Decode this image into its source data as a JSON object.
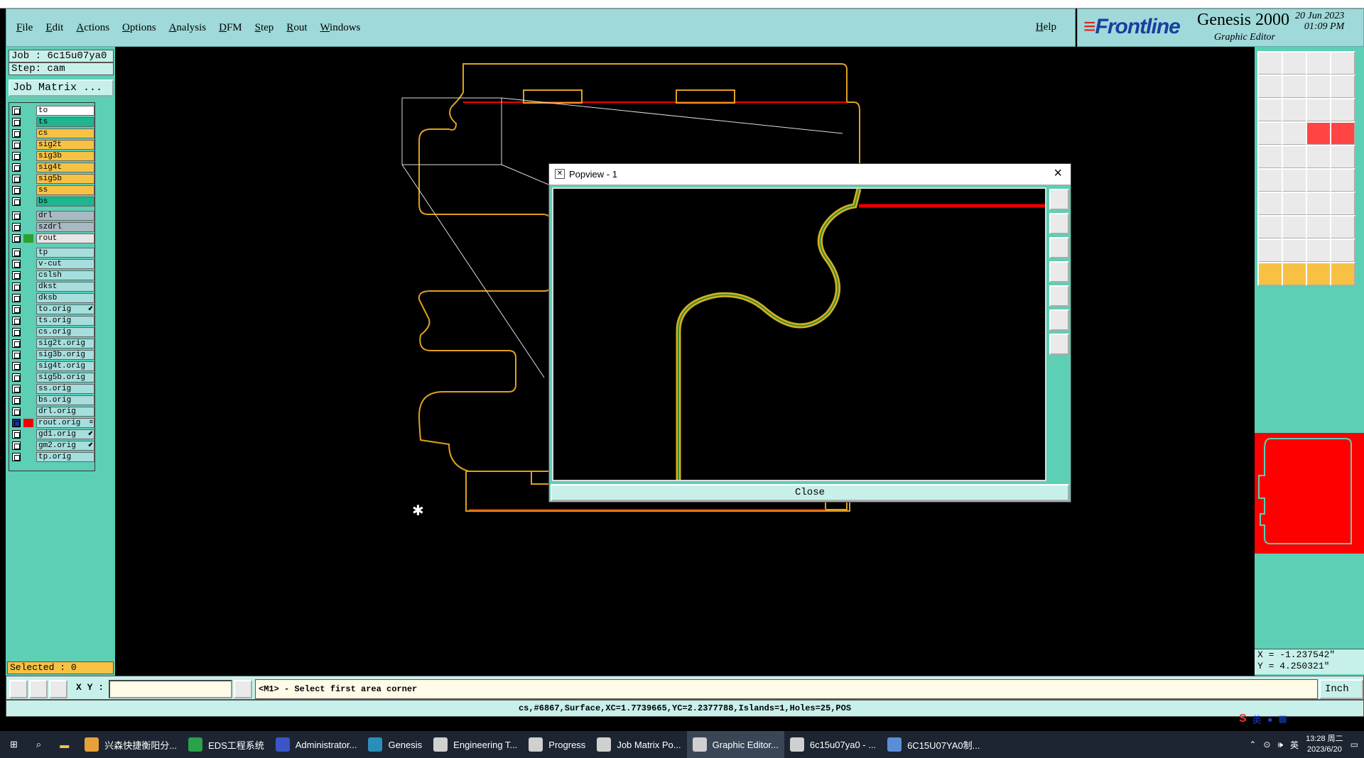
{
  "menubar": {
    "items": [
      "File",
      "Edit",
      "Actions",
      "Options",
      "Analysis",
      "DFM",
      "Step",
      "Rout",
      "Windows"
    ],
    "help": "Help"
  },
  "brand": {
    "logo": "Frontline",
    "product": "Genesis 2000",
    "subtitle": "Graphic Editor",
    "date": "20 Jun 2023",
    "time": "01:09 PM"
  },
  "left_panel": {
    "job": "Job : 6c15u07ya0",
    "step": "Step: cam",
    "job_matrix_button": "Job Matrix ...",
    "layers": [
      {
        "name": "to",
        "color": "#ffffff",
        "mark": ""
      },
      {
        "name": "ts",
        "color": "#1fb58f",
        "mark": ""
      },
      {
        "name": "cs",
        "color": "#f7c244",
        "mark": ""
      },
      {
        "name": "sig2t",
        "color": "#f7c244",
        "mark": ""
      },
      {
        "name": "sig3b",
        "color": "#f7c244",
        "mark": ""
      },
      {
        "name": "sig4t",
        "color": "#f7c244",
        "mark": ""
      },
      {
        "name": "sig5b",
        "color": "#f7c244",
        "mark": ""
      },
      {
        "name": "ss",
        "color": "#f7c244",
        "mark": ""
      },
      {
        "name": "bs",
        "color": "#1fb58f",
        "mark": ""
      },
      {
        "name": "drl",
        "color": "#a9b9c3",
        "mark": ""
      },
      {
        "name": "szdrl",
        "color": "#a9b9c3",
        "mark": ""
      },
      {
        "name": "rout",
        "color": "#e6e6e6",
        "mark": ""
      },
      {
        "name": "tp",
        "color": "#a6dede",
        "mark": ""
      },
      {
        "name": "v-cut",
        "color": "#a6dede",
        "mark": ""
      },
      {
        "name": "cslsh",
        "color": "#a6dede",
        "mark": ""
      },
      {
        "name": "dkst",
        "color": "#a6dede",
        "mark": ""
      },
      {
        "name": "dksb",
        "color": "#a6dede",
        "mark": ""
      },
      {
        "name": "to.orig",
        "color": "#a6dede",
        "mark": "⬋"
      },
      {
        "name": "ts.orig",
        "color": "#a6dede",
        "mark": ""
      },
      {
        "name": "cs.orig",
        "color": "#a6dede",
        "mark": ""
      },
      {
        "name": "sig2t.orig",
        "color": "#a6dede",
        "mark": ""
      },
      {
        "name": "sig3b.orig",
        "color": "#a6dede",
        "mark": ""
      },
      {
        "name": "sig4t.orig",
        "color": "#a6dede",
        "mark": ""
      },
      {
        "name": "sig5b.orig",
        "color": "#a6dede",
        "mark": ""
      },
      {
        "name": "ss.orig",
        "color": "#a6dede",
        "mark": ""
      },
      {
        "name": "bs.orig",
        "color": "#a6dede",
        "mark": ""
      },
      {
        "name": "drl.orig",
        "color": "#a6dede",
        "mark": ""
      },
      {
        "name": "rout.orig",
        "color": "#a6dede",
        "mark": "≡"
      },
      {
        "name": "gd1.orig",
        "color": "#a6dede",
        "mark": "⬋"
      },
      {
        "name": "gm2.orig",
        "color": "#a6dede",
        "mark": "⬋"
      },
      {
        "name": "tp.orig",
        "color": "#a6dede",
        "mark": ""
      }
    ],
    "selected": "Selected : 0"
  },
  "coords": {
    "x": "X = -1.237542\"",
    "y": "Y = 4.250321\""
  },
  "cmdbar": {
    "xy_label": "X Y :",
    "xy_value": "",
    "prompt": "<M1> - Select first area corner",
    "units": "Inch"
  },
  "status": "cs,#6867,Surface,XC=1.7739665,YC=2.2377788,Islands=1,Holes=25,POS",
  "popview": {
    "title": "Popview - 1",
    "close_label": "Close"
  },
  "taskbar": {
    "items": [
      {
        "label": "兴森快捷衡阳分...",
        "icon": "flask-icon",
        "color": "#e8a13a"
      },
      {
        "label": "EDS工程系统",
        "icon": "f-logo-icon",
        "color": "#2aa14a"
      },
      {
        "label": "Administrator...",
        "icon": "floppy-icon",
        "color": "#3a55c8"
      },
      {
        "label": "Genesis",
        "icon": "eye-icon",
        "color": "#2a8fb8"
      },
      {
        "label": "Engineering T...",
        "icon": "window-x-icon",
        "color": "#d0d0d0"
      },
      {
        "label": "Progress",
        "icon": "window-x-icon",
        "color": "#d0d0d0"
      },
      {
        "label": "Job Matrix Po...",
        "icon": "window-x-icon",
        "color": "#d0d0d0"
      },
      {
        "label": "Graphic Editor...",
        "icon": "window-x-icon",
        "color": "#d0d0d0"
      },
      {
        "label": "6c15u07ya0 - ...",
        "icon": "window-x-icon",
        "color": "#d0d0d0"
      },
      {
        "label": "6C15U07YA0制...",
        "icon": "document-icon",
        "color": "#5a8fd8"
      }
    ],
    "tray_lang": "英",
    "clock_time": "13:28 周二",
    "clock_date": "2023/6/20"
  },
  "ime": {
    "lang": "英"
  }
}
